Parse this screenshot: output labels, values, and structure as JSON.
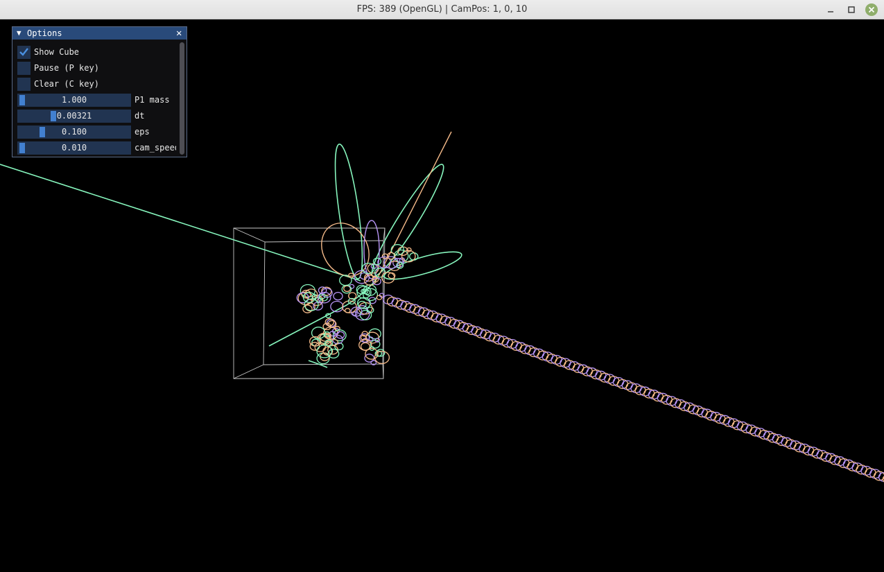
{
  "window": {
    "title": "FPS: 389 (OpenGL) | CamPos: 1, 0, 10",
    "controls": [
      "minimize-icon",
      "maximize-icon",
      "close-icon"
    ],
    "close_color": "#8fae6b"
  },
  "panel": {
    "title": "Options",
    "checkboxes": [
      {
        "label": "Show Cube",
        "checked": true
      },
      {
        "label": "Pause (P key)",
        "checked": false
      },
      {
        "label": "Clear (C key)",
        "checked": false
      }
    ],
    "sliders": [
      {
        "label": "P1 mass",
        "value": "1.000",
        "level": 0.0
      },
      {
        "label": "dt",
        "value": "0.00321",
        "level": 0.3
      },
      {
        "label": "eps",
        "value": "0.100",
        "level": 0.19
      },
      {
        "label": "cam_speed",
        "value": "0.010",
        "level": 0.0
      }
    ]
  },
  "scene": {
    "colors": {
      "green": "#86f5bd",
      "orange": "#f6bb8a",
      "purple": "#b795f5",
      "cube": "#c8c8c8",
      "background": "#000000"
    }
  }
}
